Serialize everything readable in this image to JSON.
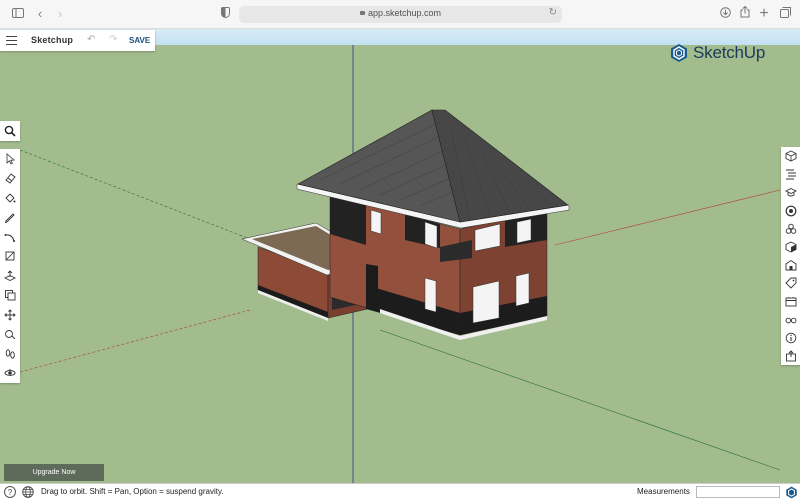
{
  "browser": {
    "url": "app.sketchup.com"
  },
  "app": {
    "title": "Sketchup",
    "save_label": "SAVE",
    "logo_text": "SketchUp"
  },
  "left_toolbar": {
    "tools": [
      "select-icon",
      "eraser-icon",
      "paint-bucket-icon",
      "pencil-icon",
      "arc-icon",
      "rectangle-icon",
      "push-pull-icon",
      "offset-icon",
      "move-icon",
      "tape-measure-icon",
      "footprint-icon",
      "orbit-icon"
    ]
  },
  "right_toolbar": {
    "panels": [
      "entity-info-icon",
      "outliner-icon",
      "instructor-icon",
      "materials-icon",
      "components-icon",
      "styles-icon",
      "scenes-icon",
      "tags-icon",
      "display-icon",
      "view-icon",
      "info-icon",
      "export-icon"
    ]
  },
  "status": {
    "upgrade_label": "Upgrade Now",
    "hint": "Drag to orbit. Shift = Pan, Option = suspend gravity.",
    "measurements_label": "Measurements",
    "measurements_value": ""
  },
  "colors": {
    "ground": "#a3bc8e",
    "sky": "#c8e4f3",
    "brand": "#1a3a5c",
    "roof": "#4e4f4e",
    "brick": "#8d4a37"
  }
}
